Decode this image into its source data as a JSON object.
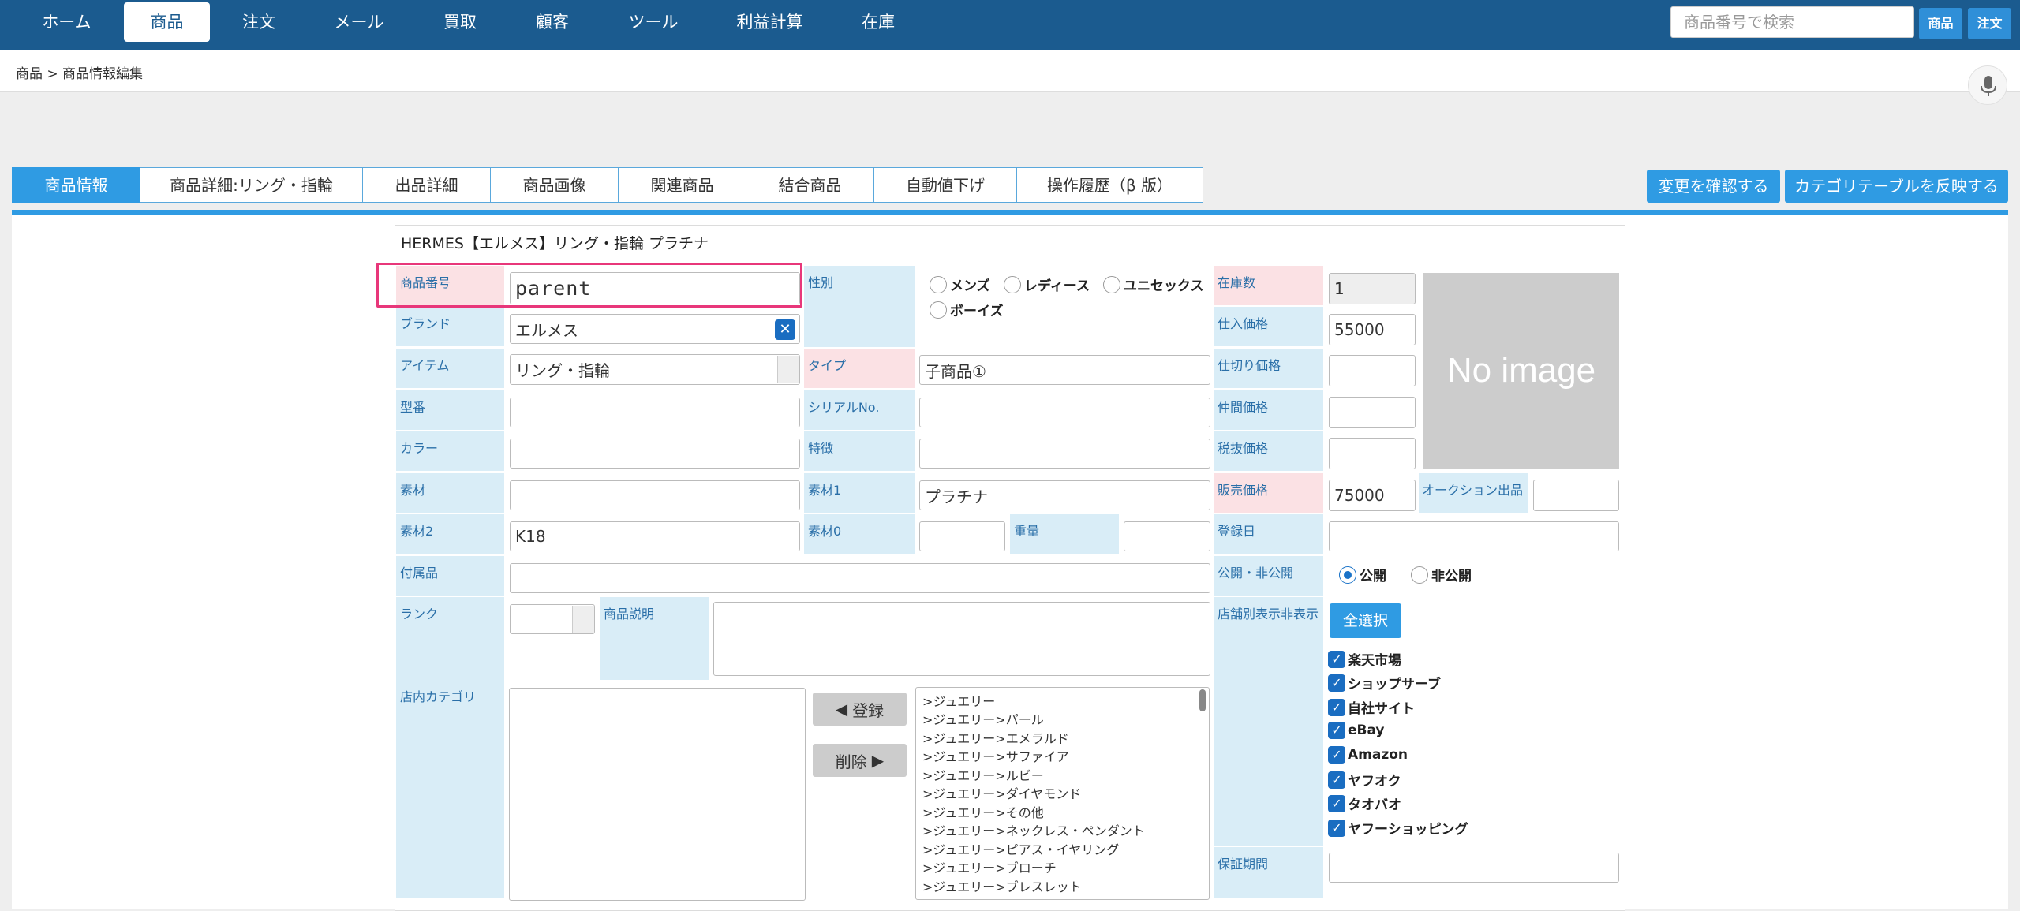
{
  "nav": {
    "items": [
      {
        "label": "ホーム"
      },
      {
        "label": "商品"
      },
      {
        "label": "注文"
      },
      {
        "label": "メール"
      },
      {
        "label": "買取"
      },
      {
        "label": "顧客"
      },
      {
        "label": "ツール"
      },
      {
        "label": "利益計算"
      },
      {
        "label": "在庫"
      }
    ],
    "search_placeholder": "商品番号で検索",
    "btn_product": "商品",
    "btn_order": "注文"
  },
  "breadcrumb": "商品 > 商品情報編集",
  "tabs": [
    {
      "label": "商品情報"
    },
    {
      "label": "商品詳細:リング・指輪"
    },
    {
      "label": "出品詳細"
    },
    {
      "label": "商品画像"
    },
    {
      "label": "関連商品"
    },
    {
      "label": "結合商品"
    },
    {
      "label": "自動値下げ"
    },
    {
      "label": "操作履歴（β 版）"
    }
  ],
  "actions": {
    "confirm": "変更を確認する",
    "apply_category": "カテゴリテーブルを反映する"
  },
  "product_title": "HERMES【エルメス】リング・指輪 プラチナ",
  "labels": {
    "product_no": "商品番号",
    "brand": "ブランド",
    "item": "アイテム",
    "model": "型番",
    "color": "カラー",
    "material": "素材",
    "material2": "素材2",
    "accessories": "付属品",
    "rank": "ランク",
    "shop_category": "店内カテゴリ",
    "gender": "性別",
    "type": "タイプ",
    "serial": "シリアルNo.",
    "feature": "特徴",
    "material1": "素材1",
    "material0": "素材0",
    "weight": "重量",
    "description": "商品説明",
    "stock": "在庫数",
    "purchase_price": "仕入価格",
    "wholesale_price": "仕切り価格",
    "broker_price": "仲間価格",
    "pretax_price": "税抜価格",
    "sale_price": "販売価格",
    "auction": "オークション出品",
    "reg_date": "登録日",
    "public": "公開・非公開",
    "store_display": "店舗別表示非表示",
    "warranty": "保証期間"
  },
  "values": {
    "product_no": "parent",
    "brand": "エルメス",
    "item": "リング・指輪",
    "material2": "K18",
    "type": "子商品①",
    "material1": "プラチナ",
    "stock": "1",
    "purchase_price": "55000",
    "sale_price": "75000"
  },
  "gender_options": [
    "メンズ",
    "レディース",
    "ユニセックス",
    "ボーイズ"
  ],
  "public_options": [
    {
      "label": "公開",
      "selected": true
    },
    {
      "label": "非公開",
      "selected": false
    }
  ],
  "no_image": "No image",
  "select_all": "全選択",
  "register_btn": "登録",
  "delete_btn": "削除",
  "stores": [
    "楽天市場",
    "ショップサーブ",
    "自社サイト",
    "eBay",
    "Amazon",
    "ヤフオク",
    "タオバオ",
    "ヤフーショッピング"
  ],
  "categories": [
    ">ジュエリー",
    ">ジュエリー>パール",
    ">ジュエリー>エメラルド",
    ">ジュエリー>サファイア",
    ">ジュエリー>ルビー",
    ">ジュエリー>ダイヤモンド",
    ">ジュエリー>その他",
    ">ジュエリー>ネックレス・ペンダント",
    ">ジュエリー>ピアス・イヤリング",
    ">ジュエリー>ブローチ",
    ">ジュエリー>ブレスレット"
  ],
  "colors": {
    "nav": "#1b5b8f",
    "accent": "#2f9be3",
    "label_bg": "#d9edf7",
    "required_bg": "#fbe1e4",
    "highlight": "#e8377a"
  }
}
